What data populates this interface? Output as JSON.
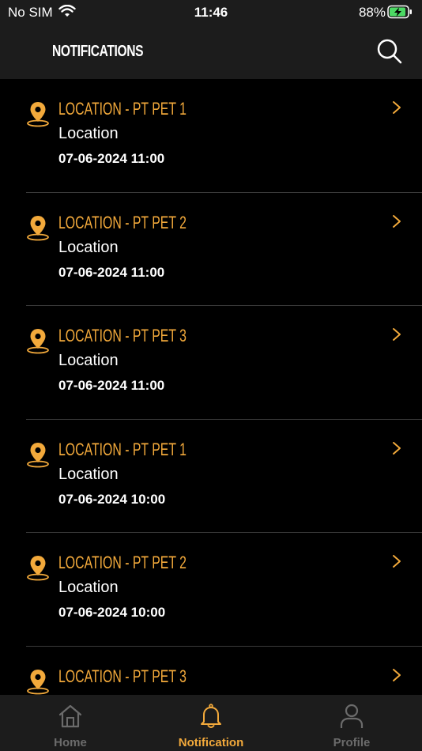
{
  "status_bar": {
    "carrier": "No SIM",
    "time": "11:46",
    "battery_percent": "88%"
  },
  "header": {
    "title": "NOTIFICATIONS"
  },
  "colors": {
    "accent": "#F2A93B",
    "background": "#000000",
    "bar": "#1c1c1c",
    "inactive_tab": "#6b6b6b"
  },
  "notifications": [
    {
      "title": "LOCATION - PT PET 1",
      "subtitle": "Location",
      "datetime": "07-06-2024 11:00"
    },
    {
      "title": "LOCATION - PT PET 2",
      "subtitle": "Location",
      "datetime": "07-06-2024 11:00"
    },
    {
      "title": "LOCATION - PT PET 3",
      "subtitle": "Location",
      "datetime": "07-06-2024 11:00"
    },
    {
      "title": "LOCATION - PT PET 1",
      "subtitle": "Location",
      "datetime": "07-06-2024 10:00"
    },
    {
      "title": "LOCATION - PT PET 2",
      "subtitle": "Location",
      "datetime": "07-06-2024 10:00"
    },
    {
      "title": "LOCATION - PT PET 3",
      "subtitle": "",
      "datetime": ""
    }
  ],
  "tabs": [
    {
      "label": "Home",
      "icon": "home-icon",
      "active": false
    },
    {
      "label": "Notification",
      "icon": "bell-icon",
      "active": true
    },
    {
      "label": "Profile",
      "icon": "user-icon",
      "active": false
    }
  ]
}
